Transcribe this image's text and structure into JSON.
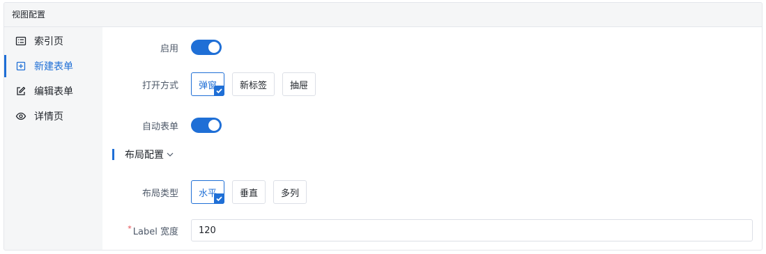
{
  "panel": {
    "title": "视图配置"
  },
  "sidebar": {
    "items": [
      {
        "label": "索引页",
        "icon": "list-icon",
        "active": false
      },
      {
        "label": "新建表单",
        "icon": "plus-square-icon",
        "active": true
      },
      {
        "label": "编辑表单",
        "icon": "edit-icon",
        "active": false
      },
      {
        "label": "详情页",
        "icon": "eye-icon",
        "active": false
      }
    ]
  },
  "form": {
    "enable": {
      "label": "启用",
      "value": true
    },
    "open_mode": {
      "label": "打开方式",
      "options": [
        "弹窗",
        "新标签",
        "抽屉"
      ],
      "selected": "弹窗"
    },
    "auto_form": {
      "label": "自动表单",
      "value": true
    },
    "layout_section": {
      "title": "布局配置"
    },
    "layout_type": {
      "label": "布局类型",
      "options": [
        "水平",
        "垂直",
        "多列"
      ],
      "selected": "水平"
    },
    "label_width": {
      "required_mark": "*",
      "label": "Label 宽度",
      "value": "120"
    }
  },
  "colors": {
    "accent": "#1f6fd6",
    "required": "#e5484d",
    "sidebar_bg": "#f5f6f7"
  }
}
